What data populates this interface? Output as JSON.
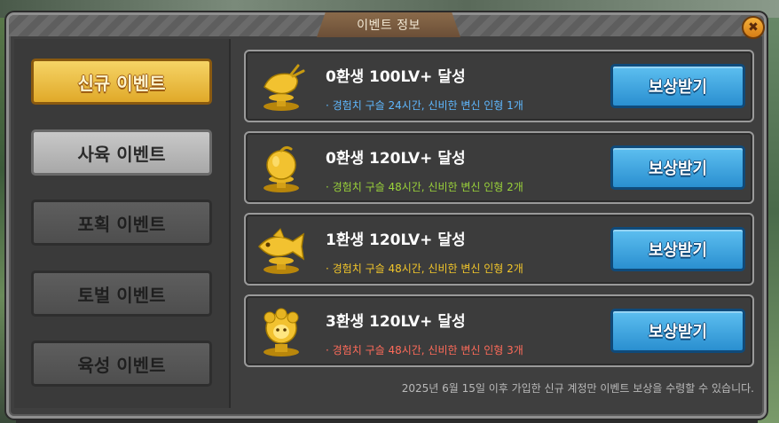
{
  "window": {
    "title": "이벤트 정보",
    "close_icon": "close-icon",
    "colors": {
      "frame": "#3f3f3f",
      "active_tab": "#e0a929",
      "claim_button": "#2a8fd0"
    }
  },
  "sidebar": {
    "items": [
      {
        "label": "신규 이벤트",
        "state": "active"
      },
      {
        "label": "사육 이벤트",
        "state": "normal"
      },
      {
        "label": "포획 이벤트",
        "state": "disabled"
      },
      {
        "label": "토벌 이벤트",
        "state": "disabled"
      },
      {
        "label": "육성 이벤트",
        "state": "disabled"
      }
    ]
  },
  "events": [
    {
      "title": "0환생 100LV+ 달성",
      "description": "· 경험치 구슬 24시간, 신비한 변신 인형 1개",
      "description_color": "#5fb8ff",
      "trophy_icon": "golden-carrot-trophy-icon",
      "button_label": "보상받기"
    },
    {
      "title": "0환생 120LV+ 달성",
      "description": "· 경험치 구슬 48시간, 신비한 변신 인형 2개",
      "description_color": "#9ad23a",
      "trophy_icon": "golden-fruit-trophy-icon",
      "button_label": "보상받기"
    },
    {
      "title": "1환생 120LV+ 달성",
      "description": "· 경험치 구슬 48시간, 신비한 변신 인형 2개",
      "description_color": "#f2c62a",
      "trophy_icon": "golden-fish-trophy-icon",
      "button_label": "보상받기"
    },
    {
      "title": "3환생 120LV+ 달성",
      "description": "· 경험치 구슬 48시간, 신비한 변신 인형 3개",
      "description_color": "#ff6b5a",
      "trophy_icon": "golden-sheep-trophy-icon",
      "button_label": "보상받기"
    }
  ],
  "notice": "2025년 6월 15일 이후 가입한 신규 계정만 이벤트 보상을 수령할 수 있습니다."
}
